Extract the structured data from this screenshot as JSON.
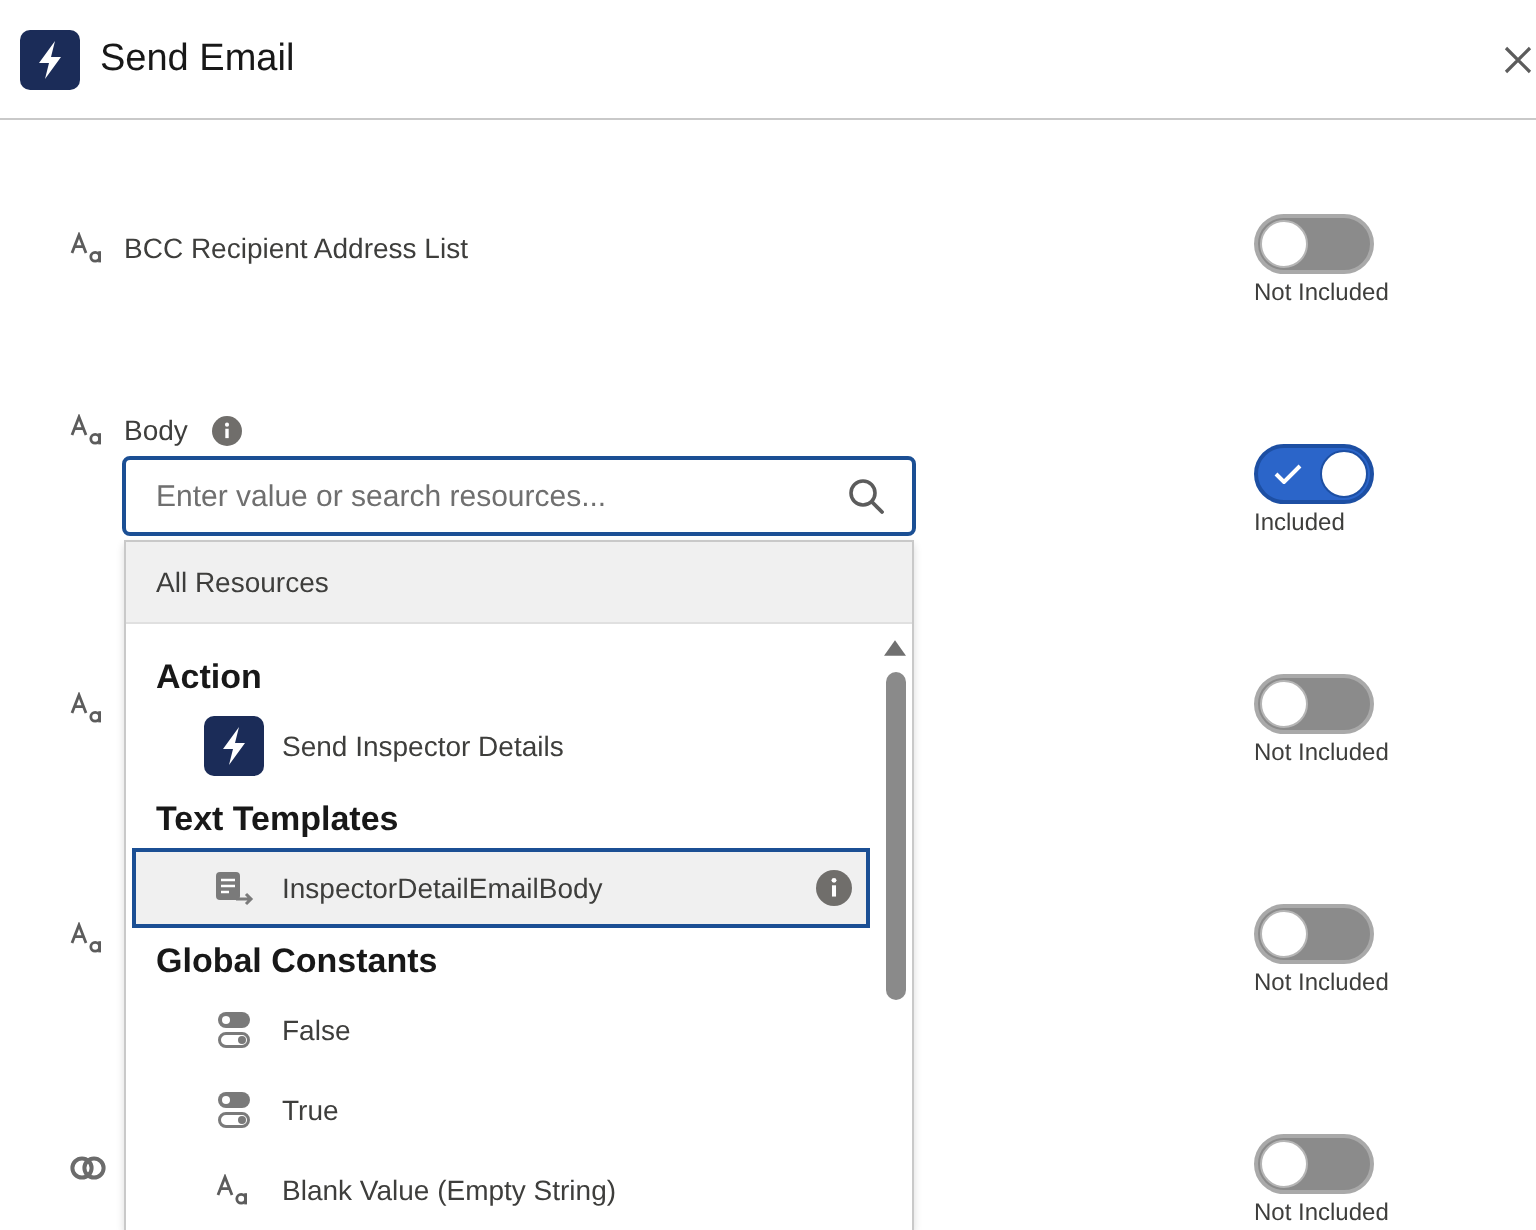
{
  "header": {
    "title": "Send Email"
  },
  "fields": [
    {
      "kind": "text",
      "label": "BCC Recipient Address List",
      "info": false,
      "included": false,
      "status": "Not Included"
    },
    {
      "kind": "text",
      "label": "Body",
      "info": true,
      "included": true,
      "status": "Included",
      "input": {
        "placeholder": "Enter value or search resources...",
        "menu": {
          "header": "All Resources",
          "groups": [
            {
              "heading": "Action",
              "items": [
                {
                  "kind": "action",
                  "label": "Send Inspector Details",
                  "selected": false
                }
              ]
            },
            {
              "heading": "Text Templates",
              "items": [
                {
                  "kind": "template",
                  "label": "InspectorDetailEmailBody",
                  "selected": true
                }
              ]
            },
            {
              "heading": "Global Constants",
              "items": [
                {
                  "kind": "boolean",
                  "label": "False",
                  "selected": false
                },
                {
                  "kind": "boolean",
                  "label": "True",
                  "selected": false
                },
                {
                  "kind": "text",
                  "label": "Blank Value (Empty String)",
                  "selected": false
                }
              ]
            }
          ]
        }
      }
    },
    {
      "kind": "text",
      "included": false,
      "status": "Not Included"
    },
    {
      "kind": "text",
      "included": false,
      "status": "Not Included"
    },
    {
      "kind": "rings",
      "included": false,
      "status": "Not Included"
    }
  ]
}
